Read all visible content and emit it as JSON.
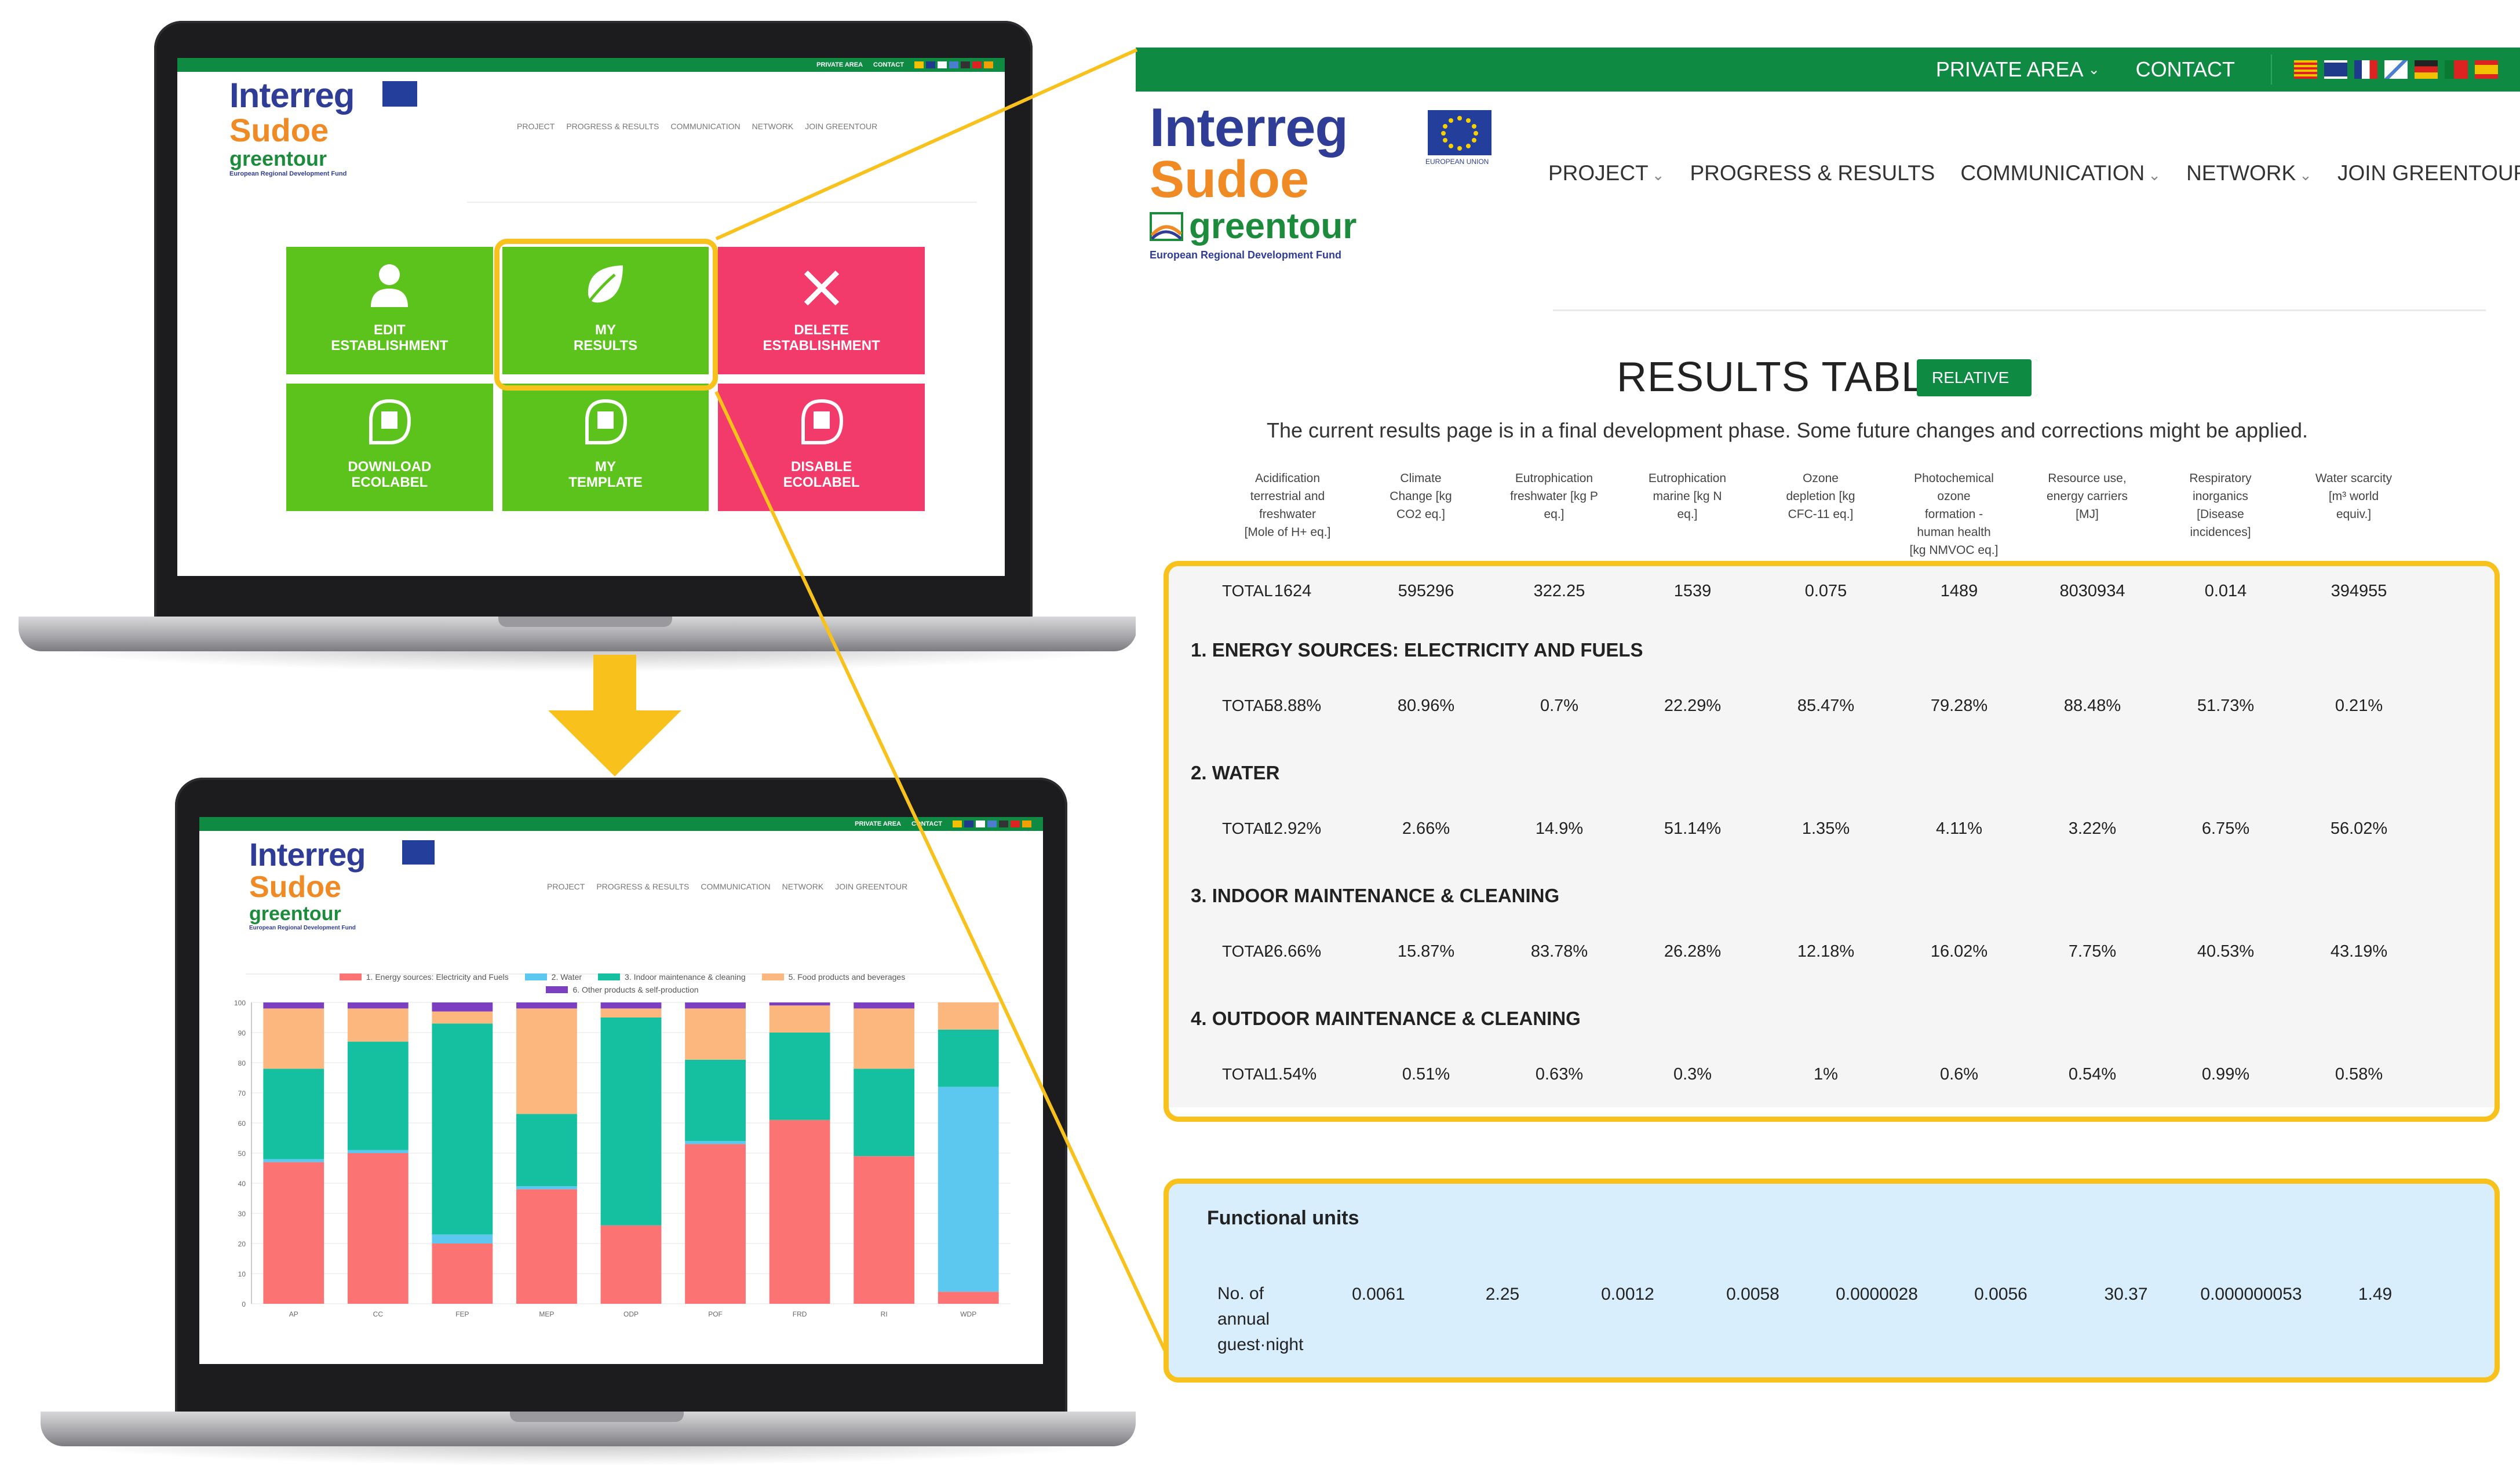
{
  "laptop_top": {
    "topbar": {
      "private": "PRIVATE AREA",
      "contact": "CONTACT"
    },
    "nav": [
      "PROJECT",
      "PROGRESS & RESULTS",
      "COMMUNICATION",
      "NETWORK",
      "JOIN GREENTOUR"
    ],
    "logo": {
      "line1": "Interreg",
      "line2": "Sudoe",
      "line3": "greentour",
      "fund": "European Regional Development Fund"
    },
    "tiles": [
      {
        "line1": "EDIT",
        "line2": "ESTABLISHMENT",
        "icon": "user-icon",
        "color": "#5cc31c"
      },
      {
        "line1": "MY",
        "line2": "RESULTS",
        "icon": "leaf-icon",
        "color": "#5cc31c"
      },
      {
        "line1": "DELETE",
        "line2": "ESTABLISHMENT",
        "icon": "close-icon",
        "color": "#f23a6b"
      },
      {
        "line1": "DOWNLOAD",
        "line2": "ECOLABEL",
        "icon": "ecolabel-icon",
        "color": "#5cc31c"
      },
      {
        "line1": "MY",
        "line2": "TEMPLATE",
        "icon": "ecolabel-icon",
        "color": "#5cc31c"
      },
      {
        "line1": "DISABLE",
        "line2": "ECOLABEL",
        "icon": "ecolabel-icon",
        "color": "#f23a6b"
      }
    ]
  },
  "laptop_bottom": {
    "topbar": {
      "private": "PRIVATE AREA",
      "contact": "CONTACT"
    },
    "nav": [
      "PROJECT",
      "PROGRESS & RESULTS",
      "COMMUNICATION",
      "NETWORK",
      "JOIN GREENTOUR"
    ],
    "logo": {
      "line1": "Interreg",
      "line2": "Sudoe",
      "line3": "greentour",
      "fund": "European Regional Development Fund"
    }
  },
  "chart_data": {
    "type": "bar",
    "stacked": true,
    "categories": [
      "AP",
      "CC",
      "FEP",
      "MEP",
      "ODP",
      "POF",
      "FRD",
      "RI",
      "WDP"
    ],
    "ylim": [
      0,
      100
    ],
    "yticks": [
      0,
      10,
      20,
      30,
      40,
      50,
      60,
      70,
      80,
      90,
      100
    ],
    "legend_placement": "top",
    "series": [
      {
        "name": "1. Energy sources: Electricity and Fuels",
        "color": "#fb7373",
        "values": [
          47,
          50,
          20,
          38,
          26,
          53,
          61,
          49,
          4
        ]
      },
      {
        "name": "2. Water",
        "color": "#5cc8f0",
        "values": [
          1,
          1,
          3,
          1,
          0,
          1,
          0,
          0,
          68
        ]
      },
      {
        "name": "3. Indoor maintenance & cleaning",
        "color": "#14c0a0",
        "values": [
          30,
          36,
          70,
          24,
          69,
          27,
          29,
          29,
          19
        ]
      },
      {
        "name": "5. Food products and beverages",
        "color": "#fbb77e",
        "values": [
          20,
          11,
          4,
          35,
          3,
          17,
          9,
          20,
          9
        ]
      },
      {
        "name": "6. Other products & self-production",
        "color": "#7b3fbf",
        "values": [
          2,
          2,
          3,
          2,
          2,
          2,
          1,
          2,
          0
        ]
      }
    ]
  },
  "results": {
    "topbar": {
      "private": "PRIVATE AREA",
      "contact": "CONTACT"
    },
    "nav": [
      "PROJECT",
      "PROGRESS & RESULTS",
      "COMMUNICATION",
      "NETWORK",
      "JOIN GREENTOUR"
    ],
    "logo": {
      "line1": "Interreg",
      "line2": "Sudoe",
      "line3": "greentour",
      "fund": "European Regional Development Fund",
      "eu": "EUROPEAN UNION"
    },
    "title": "RESULTS TABLE",
    "toggle": "RELATIVE",
    "note": "The current results page is in a final development phase. Some future changes and corrections might be applied.",
    "columns": [
      [
        "Acidification",
        "terrestrial and",
        "freshwater",
        "[Mole of H+ eq.]"
      ],
      [
        "Climate",
        "Change [kg",
        "CO2 eq.]"
      ],
      [
        "Eutrophication",
        "freshwater [kg P",
        "eq.]"
      ],
      [
        "Eutrophication",
        "marine [kg N",
        "eq.]"
      ],
      [
        "Ozone",
        "depletion [kg",
        "CFC-11 eq.]"
      ],
      [
        "Photochemical",
        "ozone",
        "formation -",
        "human health",
        "[kg NMVOC eq.]"
      ],
      [
        "Resource use,",
        "energy carriers",
        "[MJ]"
      ],
      [
        "Respiratory",
        "inorganics",
        "[Disease",
        "incidences]"
      ],
      [
        "Water scarcity",
        "[m³ world",
        "equiv.]"
      ]
    ],
    "total_label": "TOTAL",
    "total": [
      "1624",
      "595296",
      "322.25",
      "1539",
      "0.075",
      "1489",
      "8030934",
      "0.014",
      "394955"
    ],
    "sections": [
      {
        "title": "1. ENERGY SOURCES: ELECTRICITY AND FUELS",
        "values": [
          "58.88%",
          "80.96%",
          "0.7%",
          "22.29%",
          "85.47%",
          "79.28%",
          "88.48%",
          "51.73%",
          "0.21%"
        ]
      },
      {
        "title": "2. WATER",
        "values": [
          "12.92%",
          "2.66%",
          "14.9%",
          "51.14%",
          "1.35%",
          "4.11%",
          "3.22%",
          "6.75%",
          "56.02%"
        ]
      },
      {
        "title": "3. INDOOR MAINTENANCE & CLEANING",
        "values": [
          "26.66%",
          "15.87%",
          "83.78%",
          "26.28%",
          "12.18%",
          "16.02%",
          "7.75%",
          "40.53%",
          "43.19%"
        ]
      },
      {
        "title": "4. OUTDOOR MAINTENANCE & CLEANING",
        "values": [
          "1.54%",
          "0.51%",
          "0.63%",
          "0.3%",
          "1%",
          "0.6%",
          "0.54%",
          "0.99%",
          "0.58%"
        ]
      }
    ],
    "functional_units": {
      "title": "Functional units",
      "label": [
        "No. of",
        "annual",
        "guest·night"
      ],
      "values": [
        "0.0061",
        "2.25",
        "0.0012",
        "0.0058",
        "0.0000028",
        "0.0056",
        "30.37",
        "0.000000053",
        "1.49"
      ]
    }
  },
  "colors": {
    "green_bar": "#0f8a43",
    "tile_green": "#5cc31c",
    "tile_pink": "#f23a6b",
    "highlight": "#f8c11b",
    "fu_bg": "#d9eefc"
  }
}
